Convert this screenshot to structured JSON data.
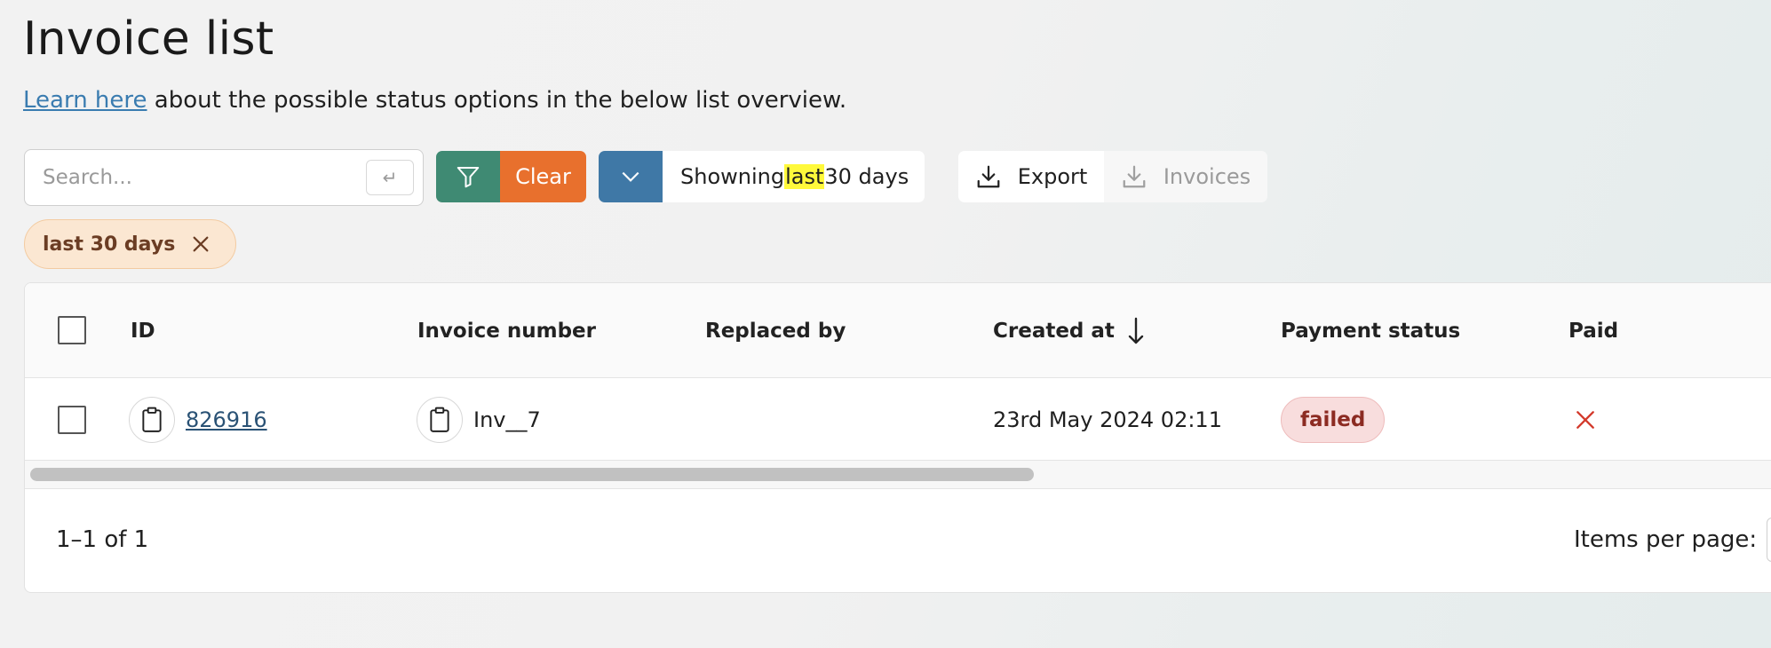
{
  "header": {
    "title": "Invoice list",
    "learn_link": "Learn here",
    "subtitle_rest": " about the possible status options in the below list overview."
  },
  "toolbar": {
    "search_placeholder": "Search...",
    "enter_key": "↵",
    "clear_label": "Clear",
    "range_prefix": "Showning ",
    "range_highlight": "last",
    "range_suffix": " 30 days",
    "export_label": "Export",
    "invoices_label": "Invoices"
  },
  "chip": {
    "label": "last 30 days"
  },
  "table": {
    "columns": {
      "id": "ID",
      "invoice_number": "Invoice number",
      "replaced_by": "Replaced by",
      "created_at": "Created at",
      "payment_status": "Payment status",
      "paid": "Paid"
    },
    "sort": {
      "column": "created_at",
      "direction": "descending"
    },
    "rows": [
      {
        "id": "826916",
        "invoice_number": "Inv__7",
        "replaced_by": "",
        "created_at": "23rd May 2024 02:11",
        "payment_status": "failed",
        "paid": false
      }
    ]
  },
  "pagination": {
    "range": "1–1 of 1",
    "items_per_page_label": "Items per page:"
  },
  "colors": {
    "filter_green": "#3f8a73",
    "clear_orange": "#e8702d",
    "chevron_blue": "#3f78a6",
    "highlight_yellow": "#fff93b",
    "failed_red": "#8c2b22",
    "paid_x_red": "#d33a2c"
  },
  "icons": {
    "filter": "filter-icon",
    "chevron": "chevron-down-icon",
    "download": "download-icon",
    "close": "close-icon",
    "copy": "clipboard-icon",
    "sort": "arrow-down-icon",
    "not_paid": "x-icon"
  }
}
